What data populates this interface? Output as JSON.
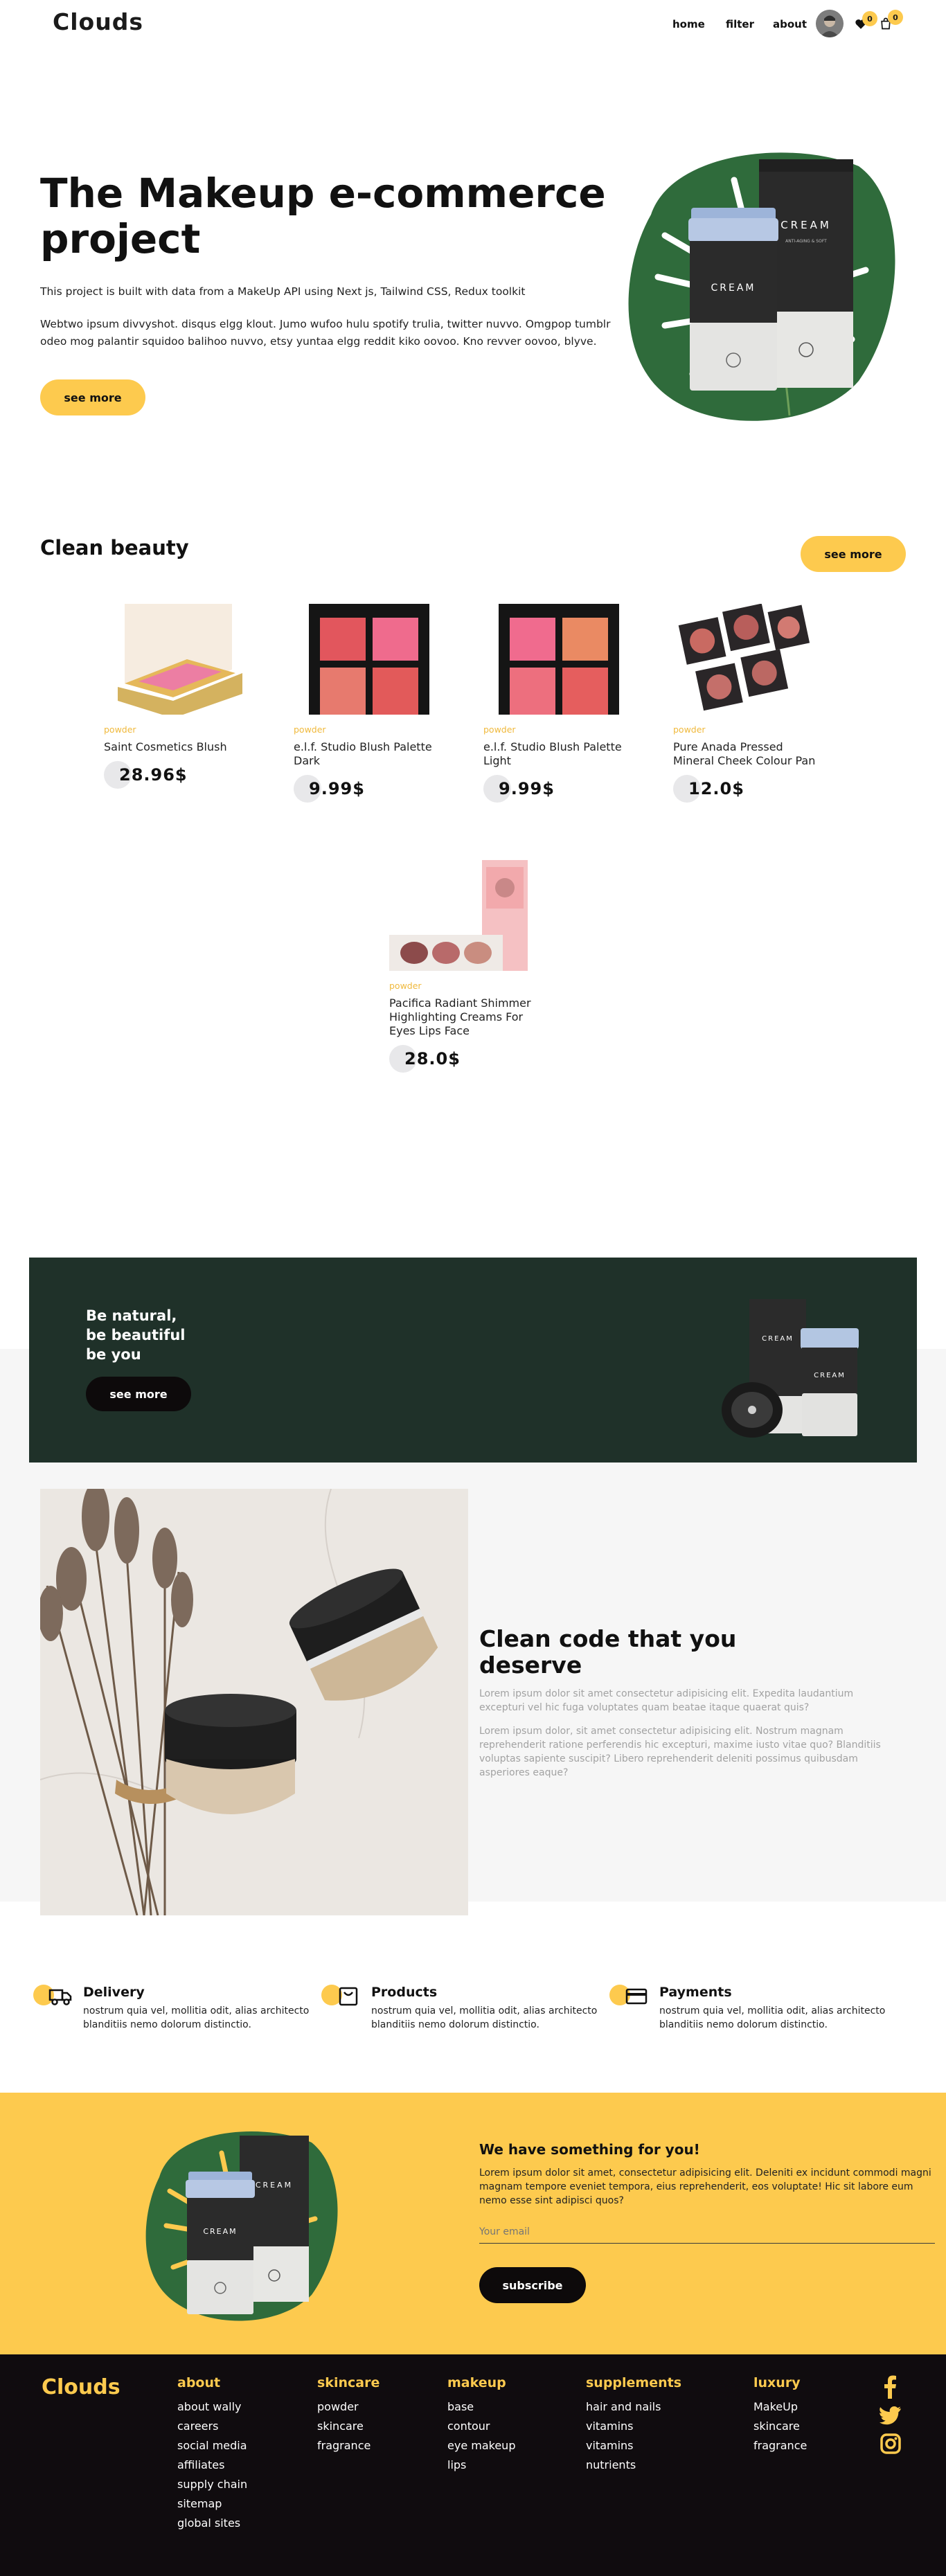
{
  "header": {
    "logo": "Clouds",
    "nav": [
      "home",
      "filter",
      "about"
    ],
    "wishlist_count": "0",
    "cart_count": "0"
  },
  "hero": {
    "title": "The Makeup e-commerce project",
    "subtitle": "This project is built with data from a MakeUp API using Next js, Tailwind CSS, Redux toolkit",
    "description": "Webtwo ipsum divvyshot. disqus elgg klout. Jumo wufoo hulu spotify trulia, twitter nuvvo. Omgpop tumblr odeo mog palantir squidoo balihoo nuvvo, etsy yuntaa elgg reddit kiko oovoo. Kno revver oovoo, blyve.",
    "button": "see more",
    "jar_label": "CREAM",
    "box_label": "CREAM",
    "box_sublabel": "ANTI-AGING & SOFT"
  },
  "clean_beauty": {
    "title": "Clean beauty",
    "button": "see more",
    "products": [
      {
        "category": "powder",
        "name": "Saint Cosmetics Blush",
        "price": "28.96$"
      },
      {
        "category": "powder",
        "name": "e.l.f. Studio Blush Palette Dark",
        "price": "9.99$"
      },
      {
        "category": "powder",
        "name": "e.l.f. Studio Blush Palette Light",
        "price": "9.99$"
      },
      {
        "category": "powder",
        "name": "Pure Anada Pressed Mineral Cheek Colour Pan",
        "price": "12.0$"
      },
      {
        "category": "powder",
        "name": "Pacifica Radiant Shimmer Highlighting Creams For Eyes Lips Face",
        "price": "28.0$"
      }
    ]
  },
  "banner": {
    "line1": "Be natural,",
    "line2": "be beautiful",
    "line3": "be you",
    "button": "see more",
    "jar_label": "CREAM",
    "box_label": "CREAM"
  },
  "clean_code": {
    "title": "Clean code that you deserve",
    "para1": "Lorem ipsum dolor sit amet consectetur adipisicing elit. Expedita laudantium excepturi vel hic fuga voluptates quam beatae itaque quaerat quis?",
    "para2": "Lorem ipsum dolor, sit amet consectetur adipisicing elit. Nostrum magnam reprehenderit ratione perferendis hic excepturi, maxime iusto vitae quo? Blanditiis voluptas sapiente suscipit? Libero reprehenderit deleniti possimus quibusdam asperiores eaque?"
  },
  "features": [
    {
      "title": "Delivery",
      "text": "nostrum quia vel, mollitia odit, alias architecto blanditiis nemo dolorum distinctio.",
      "icon": "truck-icon"
    },
    {
      "title": "Products",
      "text": "nostrum quia vel, mollitia odit, alias architecto blanditiis nemo dolorum distinctio.",
      "icon": "bag-icon"
    },
    {
      "title": "Payments",
      "text": "nostrum quia vel, mollitia odit, alias architecto blanditiis nemo dolorum distinctio.",
      "icon": "credit-card-icon"
    }
  ],
  "newsletter": {
    "title": "We have something for you!",
    "text": "Lorem ipsum dolor sit amet, consectetur adipisicing elit. Deleniti ex incidunt commodi magni magnam tempore eveniet tempora, eius reprehenderit, eos voluptate! Hic sit labore eum nemo esse sint adipisci quos?",
    "email_placeholder": "Your email",
    "button": "subscribe",
    "jar_label": "CREAM",
    "box_label": "CREAM"
  },
  "footer": {
    "logo": "Clouds",
    "columns": [
      {
        "heading": "about",
        "items": [
          "about wally",
          "careers",
          "social media",
          "affiliates",
          "supply chain",
          "sitemap",
          "global sites"
        ]
      },
      {
        "heading": "skincare",
        "items": [
          "powder",
          "skincare",
          "fragrance"
        ]
      },
      {
        "heading": "makeup",
        "items": [
          "base",
          "contour",
          "eye makeup",
          "lips"
        ]
      },
      {
        "heading": "supplements",
        "items": [
          "hair and nails",
          "vitamins",
          "vitamins",
          "nutrients"
        ]
      },
      {
        "heading": "luxury",
        "items": [
          "MakeUp",
          "skincare",
          "fragrance"
        ]
      }
    ],
    "social": [
      "facebook-icon",
      "twitter-icon",
      "instagram-icon"
    ]
  },
  "colors": {
    "accent": "#fdca4e",
    "banner_green": "#1f3129",
    "footer_bg": "#100c0f",
    "section_grey": "#f6f6f6"
  }
}
